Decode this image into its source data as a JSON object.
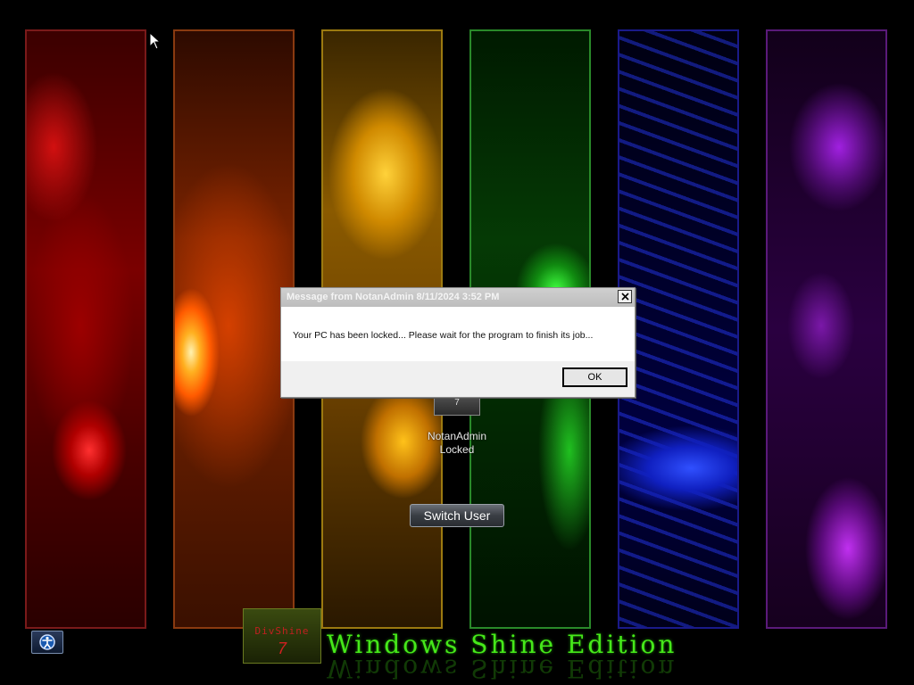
{
  "dialog": {
    "title": "Message from NotanAdmin 8/11/2024 3:52 PM",
    "message": "Your PC has been locked... Please wait for the program to finish its job...",
    "ok_label": "OK"
  },
  "user": {
    "name": "NotanAdmin",
    "status": "Locked"
  },
  "switch_user_label": "Switch User",
  "branding": {
    "logo_text": "DivShine",
    "logo_number": "7",
    "edition_text": "Windows Shine Edition"
  },
  "colors": {
    "edition_green": "#46e81a",
    "panel_red": "#b00000",
    "panel_orange": "#ff5a00",
    "panel_yellow": "#ffc21a",
    "panel_green": "#20c020",
    "panel_blue": "#1020c0",
    "panel_purple": "#a020e0"
  }
}
